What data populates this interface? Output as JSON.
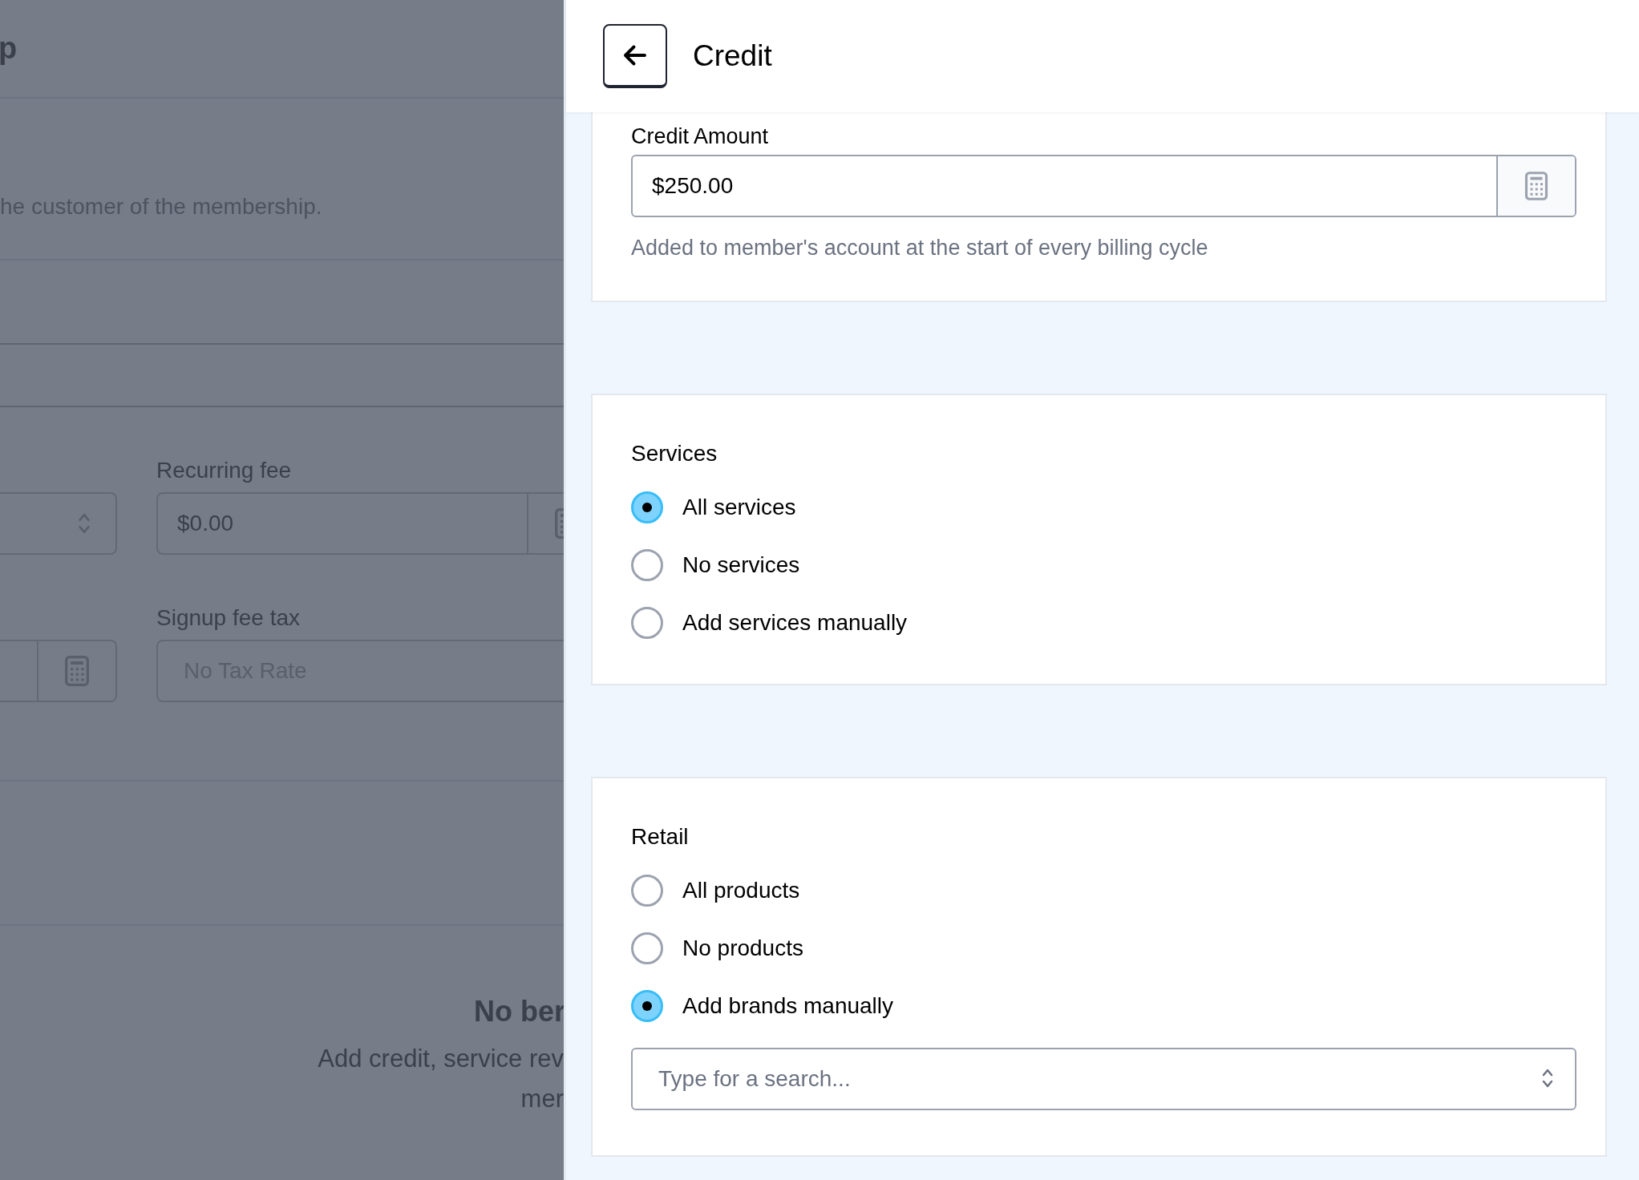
{
  "background_page": {
    "title": "p",
    "description": "he customer of the membership.",
    "recurring_fee": {
      "label": "Recurring fee",
      "value": "$0.00"
    },
    "signup_fee_tax": {
      "label": "Signup fee tax",
      "placeholder": "No Tax Rate"
    },
    "empty_state": {
      "title": "No ber",
      "lines": [
        "Add credit, service rev",
        "mer"
      ]
    }
  },
  "panel": {
    "title": "Credit",
    "credit_amount": {
      "label": "Credit Amount",
      "value": "$250.00",
      "help": "Added to member's account at the start of every billing cycle"
    },
    "sections": [
      {
        "title": "Services",
        "options": [
          {
            "label": "All services",
            "selected": true
          },
          {
            "label": "No services",
            "selected": false
          },
          {
            "label": "Add services manually",
            "selected": false
          }
        ]
      },
      {
        "title": "Retail",
        "options": [
          {
            "label": "All products",
            "selected": false
          },
          {
            "label": "No products",
            "selected": false
          },
          {
            "label": "Add brands manually",
            "selected": true
          }
        ],
        "search": {
          "placeholder": "Type for a search..."
        }
      }
    ]
  }
}
